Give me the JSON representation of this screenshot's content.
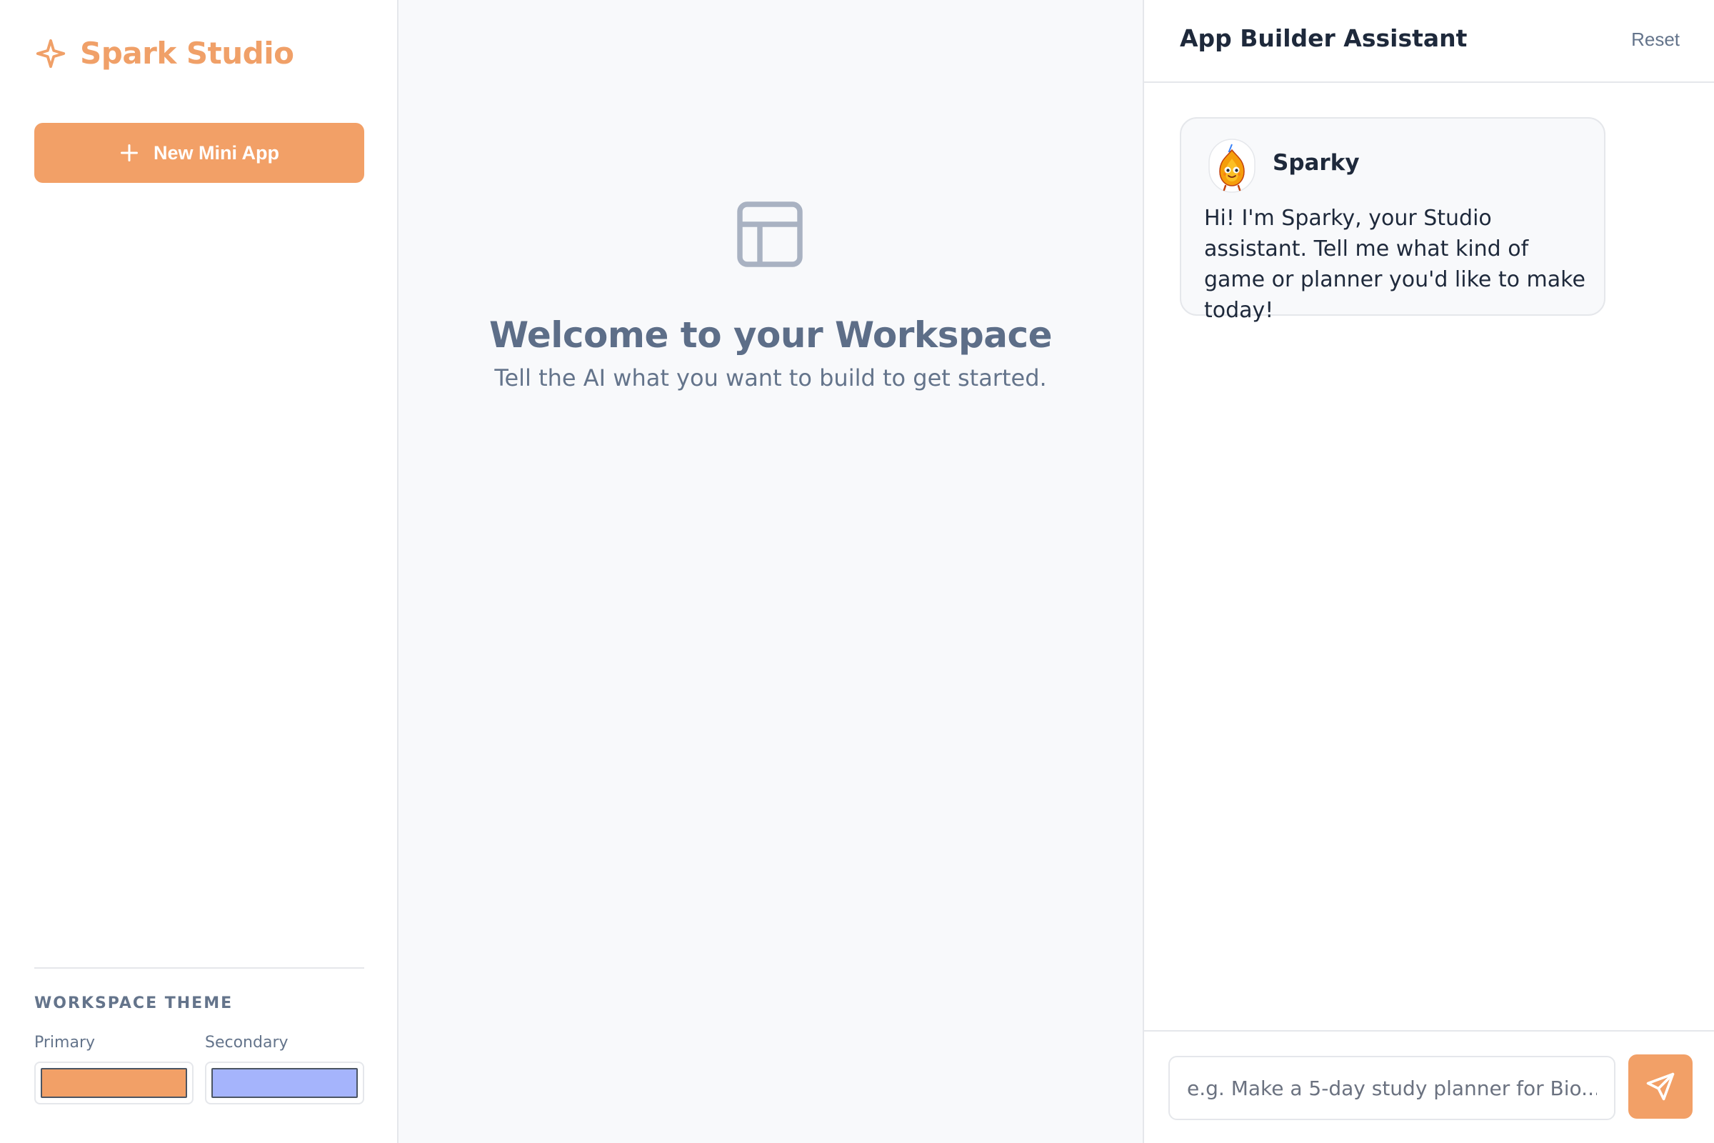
{
  "brand": {
    "name": "Spark Studio",
    "icon": "sparkle-icon"
  },
  "sidebar": {
    "new_app_label": "New Mini App",
    "theme": {
      "title": "WORKSPACE THEME",
      "primary_label": "Primary",
      "primary_color": "#f2a067",
      "secondary_label": "Secondary",
      "secondary_color": "#a5b4fc"
    }
  },
  "workspace": {
    "icon": "layout-icon",
    "title": "Welcome to your Workspace",
    "subtitle": "Tell the AI what you want to build to get started."
  },
  "assistant": {
    "title": "App Builder Assistant",
    "reset_label": "Reset",
    "messages": [
      {
        "sender": "Sparky",
        "avatar": "sparky-mascot-avatar",
        "text": "Hi! I'm Sparky, your Studio assistant. Tell me what kind of game or planner you'd like to make today!"
      }
    ],
    "input": {
      "placeholder": "e.g. Make a 5-day study planner for Bio...",
      "value": ""
    },
    "send_icon": "send-icon"
  },
  "colors": {
    "accent": "#f2a067",
    "heading": "#5d6e88",
    "muted": "#64748b"
  }
}
